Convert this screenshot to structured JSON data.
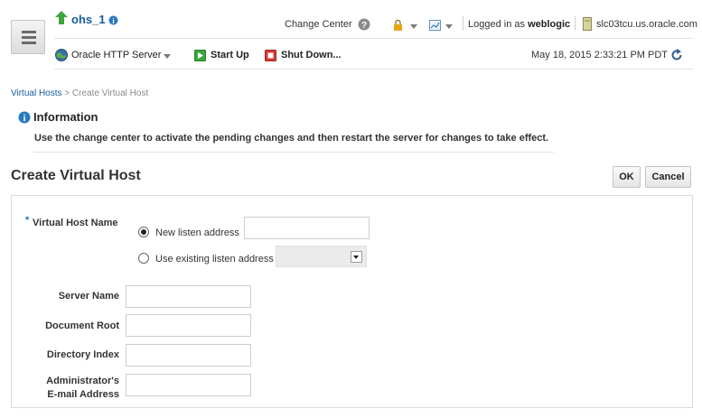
{
  "header": {
    "target_name": "ohs_1",
    "change_center_label": "Change Center",
    "logged_in_prefix": "Logged in as",
    "username": "weblogic",
    "hostname": "slc03tcu.us.oracle.com",
    "timestamp": "May 18, 2015 2:33:21 PM PDT",
    "server_menu_label": "Oracle HTTP Server",
    "start_up_label": "Start Up",
    "shut_down_label": "Shut Down..."
  },
  "breadcrumb": {
    "parent": "Virtual Hosts",
    "separator": ">",
    "current": "Create Virtual Host"
  },
  "info": {
    "title": "Information",
    "message": "Use the change center to activate the pending changes and then restart the server for changes to take effect."
  },
  "page": {
    "title": "Create Virtual Host",
    "ok_label": "OK",
    "cancel_label": "Cancel"
  },
  "form": {
    "required_marker": "*",
    "virtual_host_label": "Virtual Host Name",
    "new_listen_label": "New listen address",
    "new_listen_value": "",
    "existing_listen_label": "Use existing listen address",
    "existing_listen_value": "",
    "server_name_label": "Server Name",
    "server_name_value": "",
    "document_root_label": "Document Root",
    "document_root_value": "",
    "directory_index_label": "Directory Index",
    "directory_index_value": "",
    "admin_email_label_line1": "Administrator's",
    "admin_email_label_line2": "E-mail Address",
    "admin_email_value": ""
  },
  "icons": {
    "target_status": "green-up-arrow-icon",
    "target_info": "info-icon",
    "change_center_help": "help-icon",
    "lock": "lock-icon",
    "monitor": "chart-icon",
    "host": "server-icon",
    "refresh": "refresh-icon",
    "server_menu": "globe-icon",
    "start_up": "play-icon",
    "shut_down": "stop-icon"
  },
  "colors": {
    "link": "#145c9e",
    "start_green": "#3ea63e",
    "stop_red": "#d83a32",
    "info_blue": "#2a7bc0",
    "required": "#1d6fbd"
  }
}
